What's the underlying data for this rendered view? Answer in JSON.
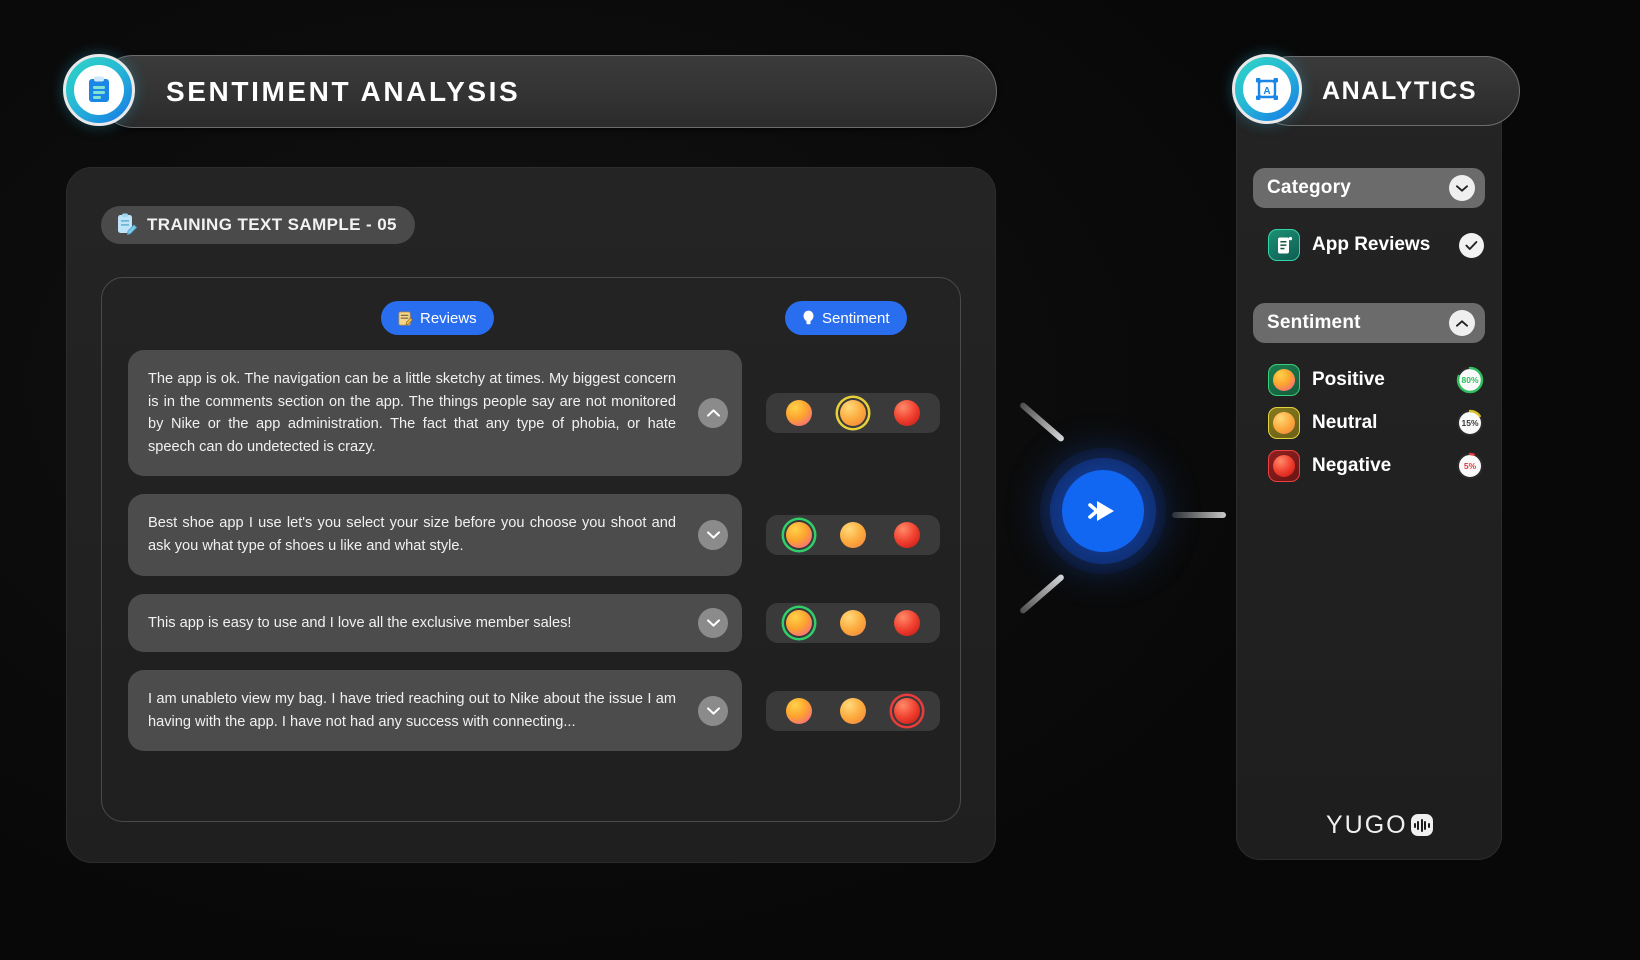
{
  "header": {
    "title": "SENTIMENT ANALYSIS",
    "logo_icon": "clipboard-icon"
  },
  "left_panel": {
    "sample_chip": {
      "icon": "document-edit-icon",
      "label": "TRAINING TEXT SAMPLE - 05"
    },
    "tabs": [
      {
        "label": "Reviews",
        "icon": "memo-icon",
        "active": true
      },
      {
        "label": "Sentiment",
        "icon": "bulb-icon",
        "active": true
      }
    ],
    "reviews": [
      {
        "text": "The app is ok. The navigation can be a little sketchy at times. My biggest concern is in the comments section on the app. The things people say are not monitored by Nike or the app administration. The fact that any type of phobia, or hate speech can do undetected is crazy.",
        "expanded": true,
        "chevron": "chevron-up-icon",
        "selected_sentiment": "neutral"
      },
      {
        "text": "Best shoe app I use let's you select your size before you choose you shoot and ask you what type of shoes u like and what style.",
        "expanded": false,
        "chevron": "chevron-down-icon",
        "selected_sentiment": "positive"
      },
      {
        "text": "This app is easy to use and I love all the exclusive member sales!",
        "expanded": false,
        "chevron": "chevron-down-icon",
        "selected_sentiment": "positive"
      },
      {
        "text": "I am unableto view my bag. I have tried reaching out to Nike about the issue I am having with the app. I have not had any success with connecting...",
        "expanded": false,
        "chevron": "chevron-down-icon",
        "selected_sentiment": "negative"
      }
    ]
  },
  "connector": {
    "node_icon": "double-chevron-play-icon",
    "node_color": "#1166f2"
  },
  "right_panel": {
    "header": {
      "title": "ANALYTICS",
      "logo_icon": "ai-frame-icon"
    },
    "category_section": {
      "title": "Category",
      "toggle_icon": "chevron-down-icon",
      "items": [
        {
          "label": "App Reviews",
          "icon": "reviews-doc-icon",
          "checked": true,
          "check_icon": "check-icon"
        }
      ]
    },
    "sentiment_section": {
      "title": "Sentiment",
      "toggle_icon": "chevron-up-icon",
      "items": [
        {
          "label": "Positive",
          "icon": "grinning-face-icon",
          "value": "80%",
          "percent": 80,
          "color": "#2fbf5e"
        },
        {
          "label": "Neutral",
          "icon": "neutral-face-icon",
          "value": "15%",
          "percent": 15,
          "color": "#d9bf26"
        },
        {
          "label": "Negative",
          "icon": "angry-face-icon",
          "value": "5%",
          "percent": 5,
          "color": "#e23b3b"
        }
      ]
    },
    "brand": {
      "text": "YUGO",
      "mark_icon": "sound-wave-icon"
    }
  }
}
